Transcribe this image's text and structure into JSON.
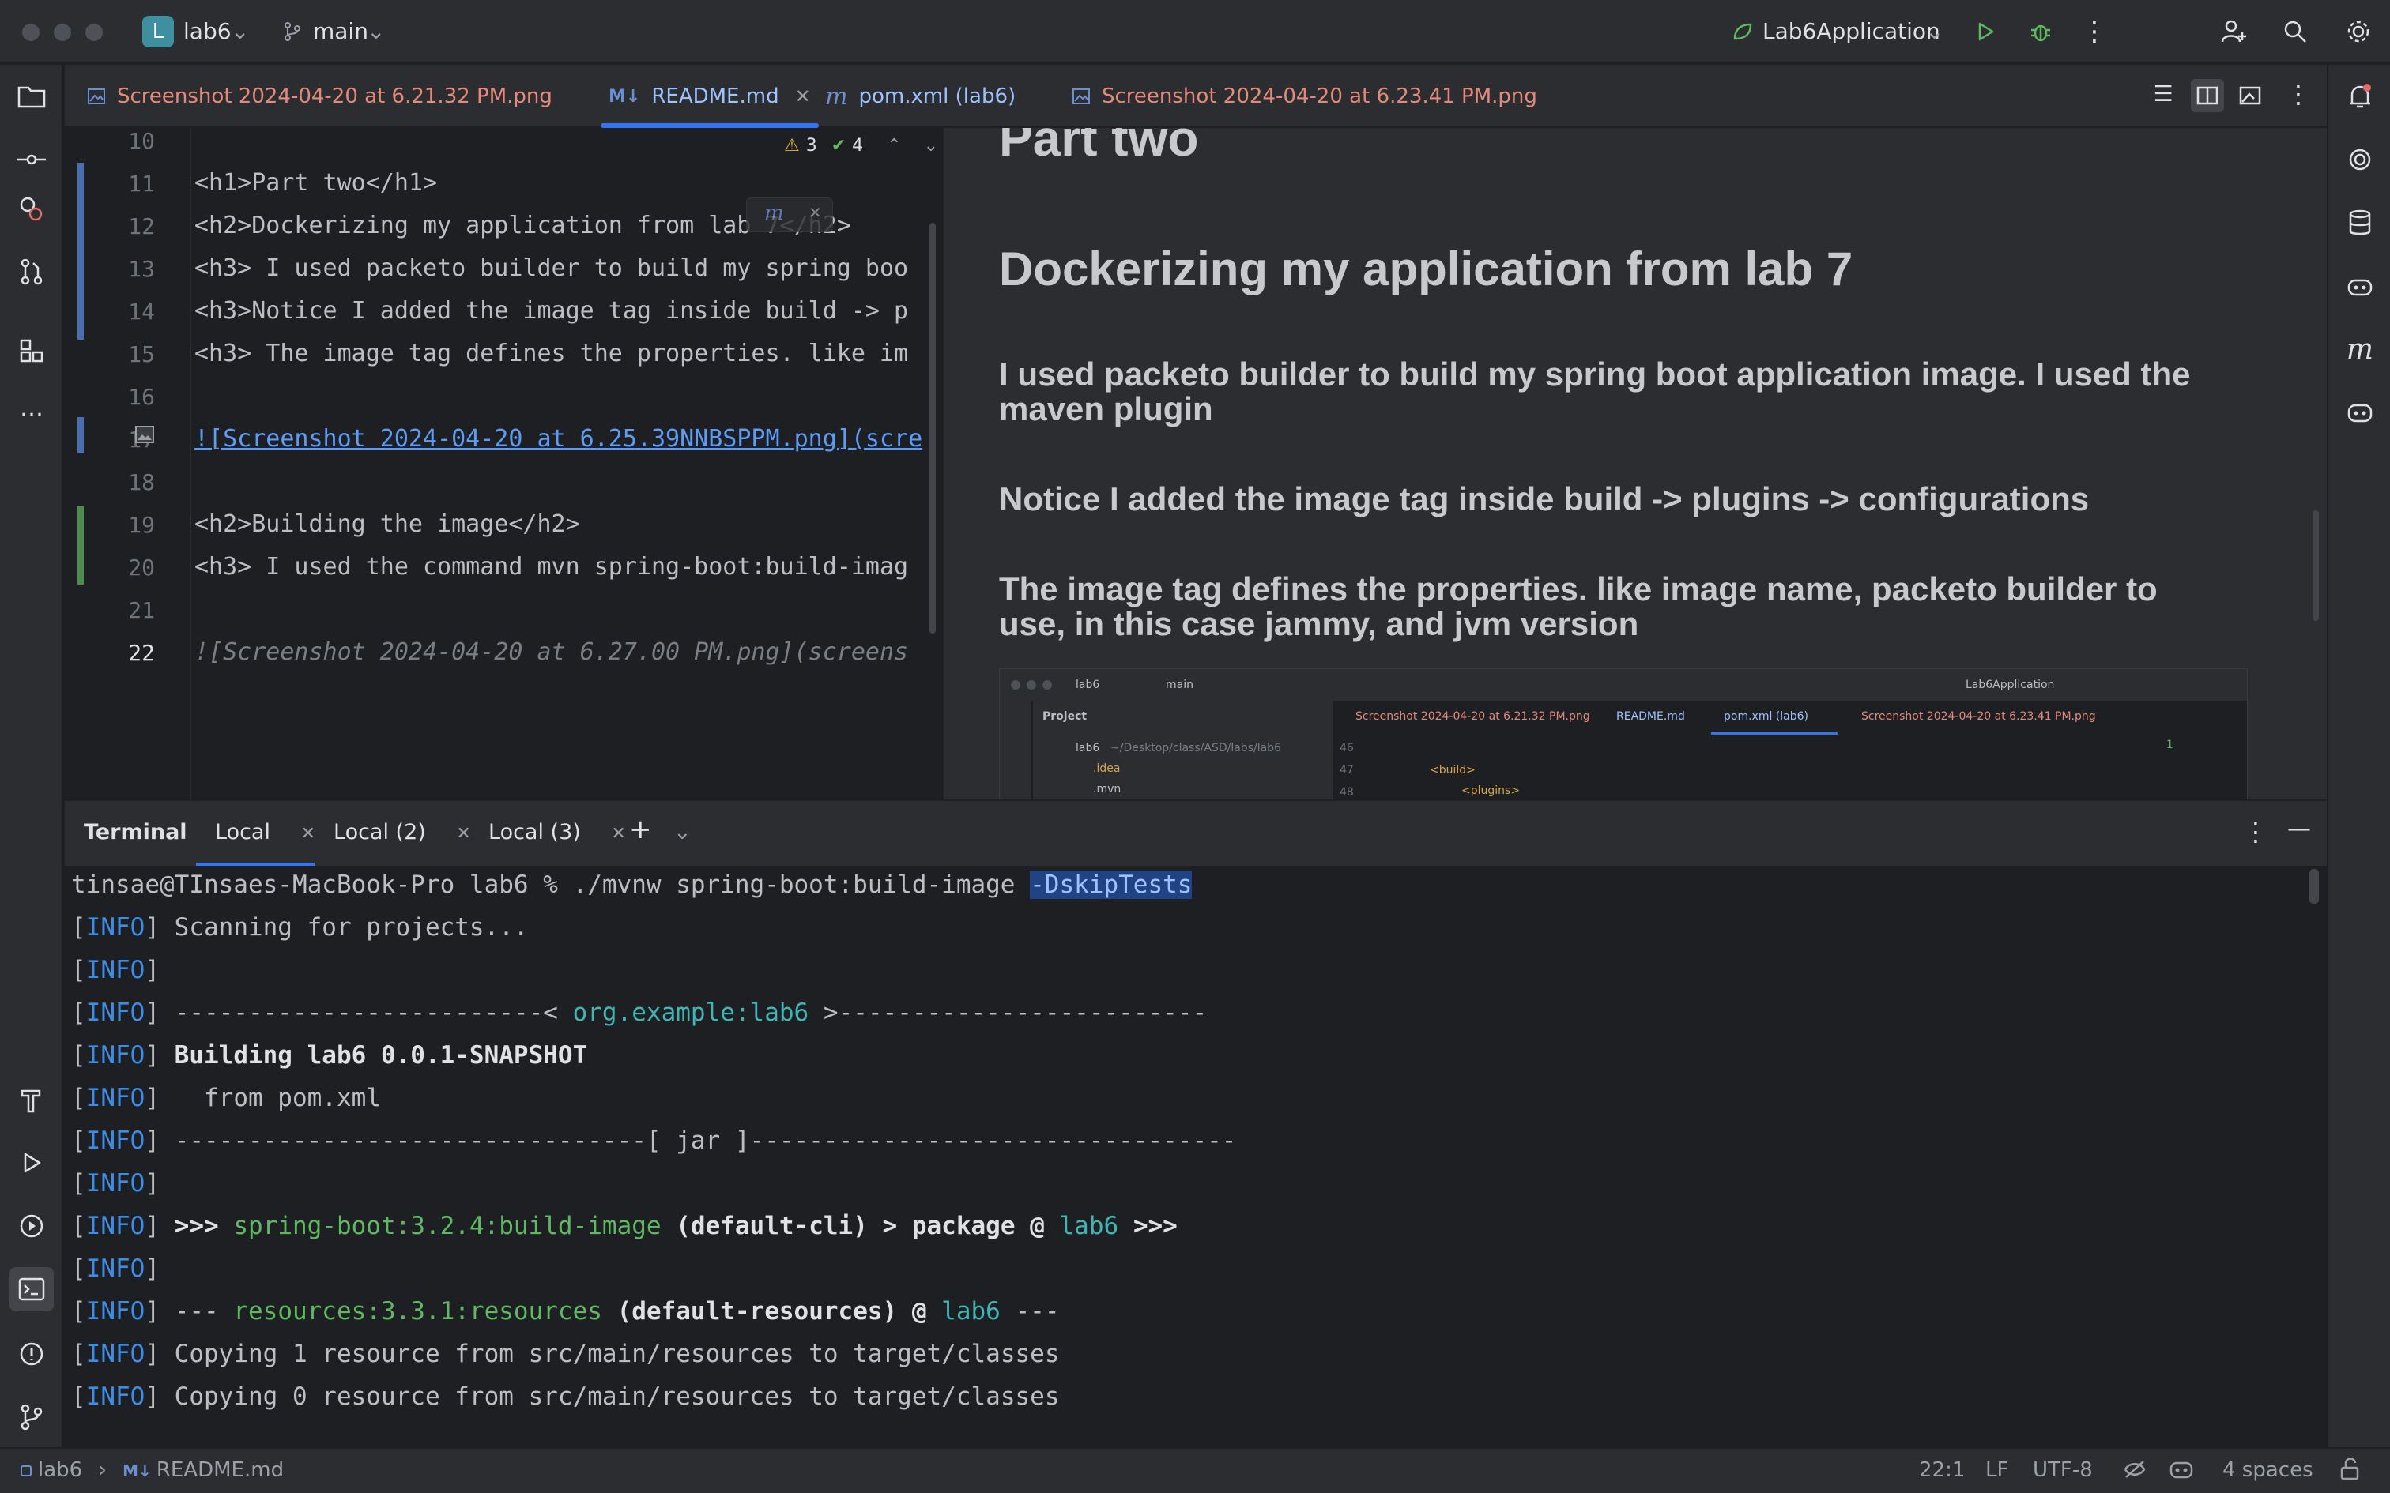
{
  "titlebar": {
    "project_initial": "L",
    "project_name": "lab6",
    "branch": "main",
    "run_config": "Lab6Application"
  },
  "tabs": [
    {
      "label": "Screenshot 2024-04-20 at 6.21.32 PM.png",
      "icon": "image-icon",
      "active": false
    },
    {
      "label": "README.md",
      "icon": "markdown-icon",
      "active": true
    },
    {
      "label": "pom.xml (lab6)",
      "icon": "maven-icon",
      "active": false
    },
    {
      "label": "Screenshot 2024-04-20 at 6.23.41 PM.png",
      "icon": "image-icon",
      "active": false
    }
  ],
  "editor": {
    "warnings": "3",
    "checks": "4",
    "lines": [
      {
        "no": "10",
        "text": ""
      },
      {
        "no": "11",
        "text": "<h1>Part two</h1>"
      },
      {
        "no": "12",
        "text": "<h2>Dockerizing my application from lab 7</h2>"
      },
      {
        "no": "13",
        "text": "<h3> I used packeto builder to build my spring boo"
      },
      {
        "no": "14",
        "text": "<h3>Notice I added the image tag inside build -> p"
      },
      {
        "no": "15",
        "text": "<h3> The image tag defines the properties. like im"
      },
      {
        "no": "16",
        "text": ""
      },
      {
        "no": "17",
        "text": "![Screenshot 2024-04-20 at 6.25.39NNBSPPM.png](scre"
      },
      {
        "no": "18",
        "text": ""
      },
      {
        "no": "19",
        "text": "<h2>Building the image</h2>"
      },
      {
        "no": "20",
        "text": "<h3> I used the command mvn spring-boot:build-imag"
      },
      {
        "no": "21",
        "text": ""
      },
      {
        "no": "22",
        "text": "![Screenshot 2024-04-20 at 6.27.00 PM.png](screens"
      }
    ]
  },
  "preview": {
    "h1_partial": "Part two",
    "h2": "Dockerizing my application from lab 7",
    "p1": "I used packeto builder to build my spring boot application image. I used the maven plugin",
    "p2": "Notice I added the image tag inside build -> plugins -> configurations",
    "p3": "The image tag defines the properties. like image name, packeto builder to use, in this case jammy, and jvm version",
    "mini": {
      "project": "lab6",
      "branch": "main",
      "run_config": "Lab6Application",
      "panel": "Project",
      "tab1": "Screenshot 2024-04-20 at 6.21.32 PM.png",
      "tab2": "README.md",
      "tab3": "pom.xml (lab6)",
      "tab4": "Screenshot 2024-04-20 at 6.23.41 PM.png",
      "tree_root": "lab6",
      "tree_path": "~/Desktop/class/ASD/labs/lab6",
      "tree_idea": ".idea",
      "tree_mvn": ".mvn",
      "ln46": "46",
      "ln47": "47",
      "ln48": "48",
      "code_build": "<build>",
      "code_plugins": "<plugins>",
      "badge": "1"
    }
  },
  "terminal": {
    "title": "Terminal",
    "tabs": [
      "Local",
      "Local (2)",
      "Local (3)"
    ],
    "prompt": "tinsae@TInsaes-MacBook-Pro lab6 % ./mvnw spring-boot:build-image ",
    "prompt_hl": "-DskipTests",
    "info": "[INFO]",
    "l1": " Scanning for projects...",
    "l3a": " -------------------------< ",
    "l3b": "org.example:lab6",
    "l3c": " >-------------------------",
    "l4": " Building lab6 0.0.1-SNAPSHOT",
    "l5": "   from pom.xml",
    "l6": " --------------------------------[ jar ]---------------------------------",
    "l8a": " >>> ",
    "l8b": "spring-boot:3.2.4:build-image",
    "l8c": " (default-cli) > package @ ",
    "l8d": "lab6",
    "l8e": " >>>",
    "l10a": " --- ",
    "l10b": "resources:3.3.1:resources",
    "l10c": " (default-resources) @ ",
    "l10d": "lab6",
    "l10e": " ---",
    "l11": " Copying 1 resource from src/main/resources to target/classes",
    "l12": " Copying 0 resource from src/main/resources to target/classes"
  },
  "statusbar": {
    "crumb_project": "lab6",
    "crumb_file": "README.md",
    "position": "22:1",
    "line_sep": "LF",
    "encoding": "UTF-8",
    "indent": "4 spaces"
  }
}
